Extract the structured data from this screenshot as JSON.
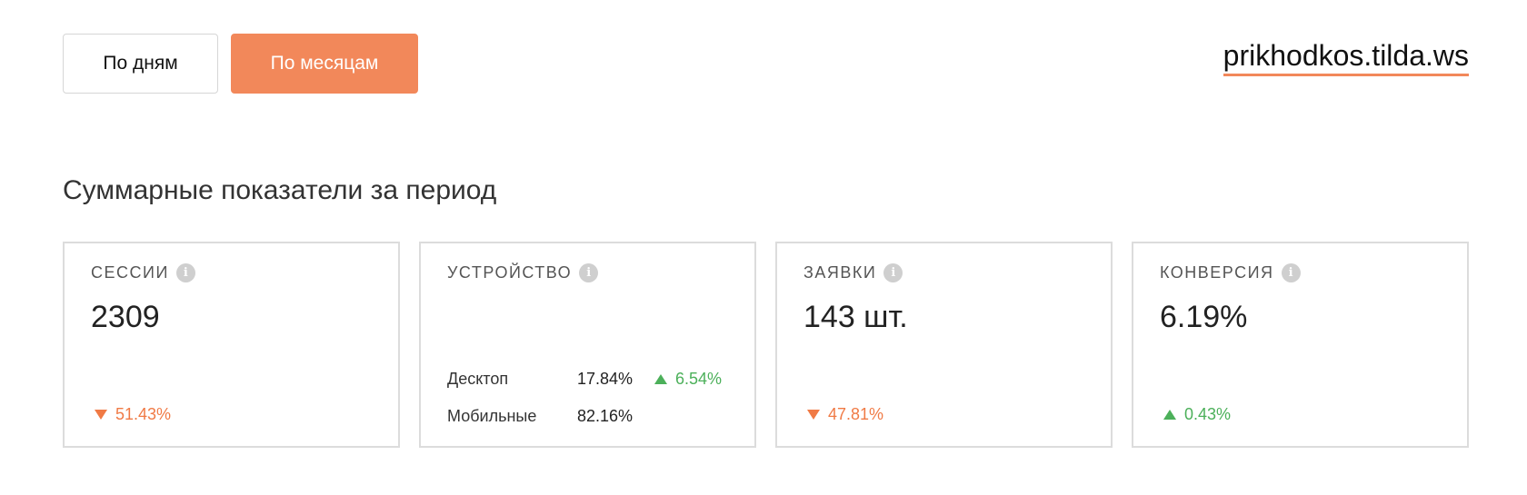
{
  "controls": {
    "by_days": "По дням",
    "by_months": "По месяцам"
  },
  "site": {
    "link": "prikhodkos.tilda.ws"
  },
  "section": {
    "title": "Суммарные показатели за период"
  },
  "cards": {
    "sessions": {
      "label": "СЕССИИ",
      "value": "2309",
      "delta": "51.43%",
      "delta_direction": "down"
    },
    "device": {
      "label": "УСТРОЙСТВО",
      "rows": [
        {
          "name": "Десктоп",
          "pct": "17.84%",
          "delta": "6.54%",
          "delta_direction": "up"
        },
        {
          "name": "Мобильные",
          "pct": "82.16%"
        }
      ]
    },
    "leads": {
      "label": "ЗАЯВКИ",
      "value": "143 шт.",
      "delta": "47.81%",
      "delta_direction": "down"
    },
    "conversion": {
      "label": "КОНВЕРСИЯ",
      "value": "6.19%",
      "delta": "0.43%",
      "delta_direction": "up"
    }
  },
  "icons": {
    "info": "info-icon",
    "delta_down": "triangle-down-icon",
    "delta_up": "triangle-up-icon"
  },
  "colors": {
    "accent": "#f2885a",
    "negative": "#f07a45",
    "positive": "#4cb05a",
    "border": "#dcdcdc"
  }
}
